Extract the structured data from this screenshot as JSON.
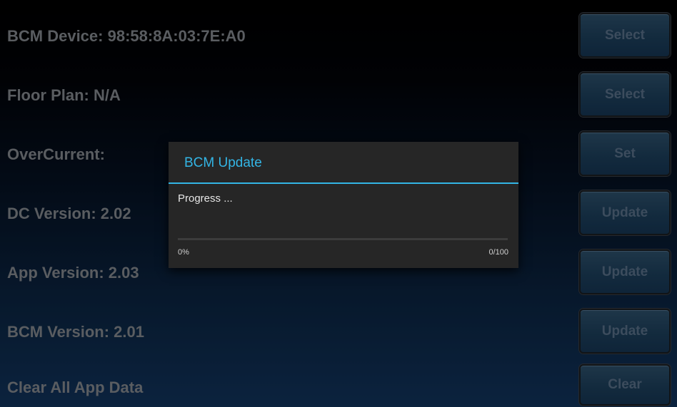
{
  "rows": [
    {
      "label": "BCM Device: 98:58:8A:03:7E:A0",
      "button": "Select"
    },
    {
      "label": "Floor Plan:  N/A",
      "button": "Select"
    },
    {
      "label": "OverCurrent:",
      "button": "Set"
    },
    {
      "label": "DC Version:  2.02",
      "button": "Update"
    },
    {
      "label": "App Version:  2.03",
      "button": "Update"
    },
    {
      "label": "BCM Version:  2.01",
      "button": "Update"
    },
    {
      "label": "Clear All App Data",
      "button": "Clear"
    }
  ],
  "dialog": {
    "title": "BCM Update",
    "message": "Progress ...",
    "percent_text": "0%",
    "count_text": "0/100",
    "progress_fraction": 0
  },
  "colors": {
    "accent": "#33b5e5",
    "label_text": "#8b8f95",
    "button_text": "#5d7690",
    "dialog_bg": "#262626"
  }
}
